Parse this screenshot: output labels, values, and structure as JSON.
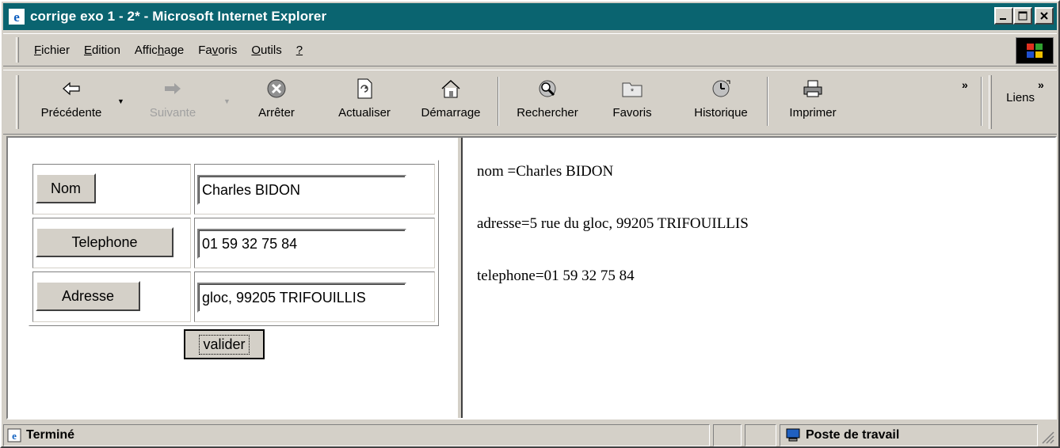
{
  "window": {
    "title": "corrige exo 1 - 2* - Microsoft Internet Explorer"
  },
  "menubar": {
    "items": [
      {
        "pre": "",
        "key": "F",
        "post": "ichier"
      },
      {
        "pre": "",
        "key": "E",
        "post": "dition"
      },
      {
        "pre": "Affic",
        "key": "h",
        "post": "age"
      },
      {
        "pre": "Fa",
        "key": "v",
        "post": "oris"
      },
      {
        "pre": "",
        "key": "O",
        "post": "utils"
      },
      {
        "pre": "",
        "key": "?",
        "post": ""
      }
    ]
  },
  "toolbar": {
    "back": "Précédente",
    "forward": "Suivante",
    "stop": "Arrêter",
    "refresh": "Actualiser",
    "home": "Démarrage",
    "search": "Rechercher",
    "favorites": "Favoris",
    "history": "Historique",
    "print": "Imprimer",
    "links": "Liens",
    "chevron": "»"
  },
  "form": {
    "nom_button": "Nom",
    "nom_value": "Charles BIDON",
    "telephone_button": "Telephone",
    "telephone_value": "01 59 32 75 84",
    "adresse_button": "Adresse",
    "adresse_value": "gloc, 99205 TRIFOUILLIS",
    "submit": "valider"
  },
  "result": {
    "line1": "nom =Charles BIDON",
    "line2": "adresse=5 rue du gloc, 99205 TRIFOUILLIS",
    "line3": "telephone=01 59 32 75 84"
  },
  "status": {
    "text": "Terminé",
    "zone": "Poste de travail"
  }
}
